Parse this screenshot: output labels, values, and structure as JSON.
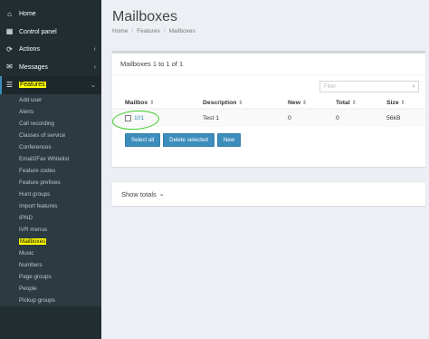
{
  "sidebar": {
    "items": [
      {
        "label": "Home",
        "icon": "home-icon",
        "glyph": "⌂",
        "chev": ""
      },
      {
        "label": "Control panel",
        "icon": "control-panel-icon",
        "glyph": "▦",
        "chev": ""
      },
      {
        "label": "Actions",
        "icon": "refresh-icon",
        "glyph": "⟳",
        "chev": "‹"
      },
      {
        "label": "Messages",
        "icon": "envelope-icon",
        "glyph": "✉",
        "chev": "‹"
      },
      {
        "label": "Features",
        "icon": "list-icon",
        "glyph": "☰",
        "chev": "⌄"
      }
    ],
    "submenu": [
      "Add user",
      "Alerts",
      "Call recording",
      "Classes of service",
      "Conferences",
      "Email2Fax Whitelist",
      "Feature codes",
      "Feature prefixes",
      "Hunt groups",
      "Import features",
      "IPND",
      "IVR menus",
      "Mailboxes",
      "Music",
      "Numbers",
      "Page groups",
      "People",
      "Pickup groups"
    ]
  },
  "page": {
    "title": "Mailboxes",
    "breadcrumb": [
      "Home",
      "Features",
      "Mailboxes"
    ]
  },
  "box": {
    "header": "Mailboxes 1 to 1 of 1",
    "search_placeholder": "Filter",
    "columns": [
      "Mailbox",
      "Description",
      "New",
      "Total",
      "Size"
    ],
    "rows": [
      {
        "mailbox": "101",
        "description": "Test 1",
        "new": "0",
        "total": "0",
        "size": "56kB"
      }
    ],
    "buttons": {
      "select_all": "Select all",
      "delete_selected": "Delete selected",
      "new": "New"
    }
  },
  "totals": {
    "label": "Show totals"
  },
  "colors": {
    "sidebar_bg": "#222d32",
    "accent": "#3c8dbc",
    "highlight": "#ffff00",
    "annotation": "#3ecc2a"
  }
}
